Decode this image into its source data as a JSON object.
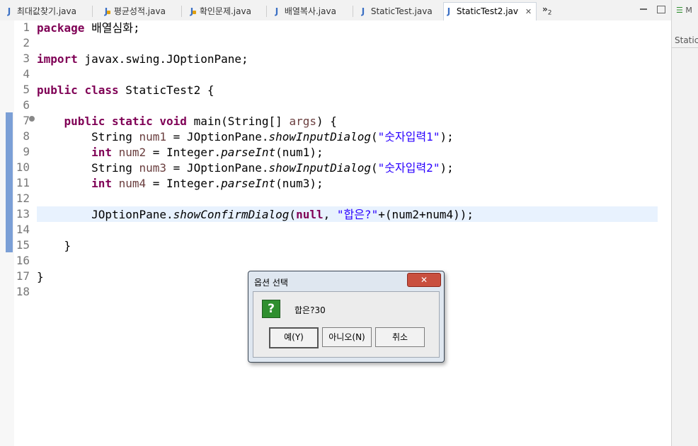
{
  "tabs": [
    {
      "label": "최대값찾기.java",
      "icon": "java-file-icon"
    },
    {
      "label": "평균성적.java",
      "icon": "java-file-warning-icon"
    },
    {
      "label": "확인문제.java",
      "icon": "java-file-warning-icon"
    },
    {
      "label": "배열복사.java",
      "icon": "java-file-icon"
    },
    {
      "label": "StaticTest.java",
      "icon": "java-file-icon"
    },
    {
      "label": "StaticTest2.jav",
      "icon": "java-file-icon"
    }
  ],
  "tab_close": "✕",
  "overflow": {
    "label": "»",
    "count": "2"
  },
  "right_panel": {
    "top": "M",
    "label": "StaticT"
  },
  "line_numbers": [
    "1",
    "2",
    "3",
    "4",
    "5",
    "6",
    "7",
    "8",
    "9",
    "10",
    "11",
    "12",
    "13",
    "14",
    "15",
    "16",
    "17",
    "18"
  ],
  "code": {
    "l1": {
      "kw": "package",
      "rest": " 배열심화;"
    },
    "l3": {
      "kw": "import",
      "rest": " javax.swing.JOptionPane;"
    },
    "l5": {
      "kw1": "public",
      "kw2": "class",
      "rest": " StaticTest2 {"
    },
    "l7": {
      "indent": "    ",
      "kw1": "public",
      "kw2": "static",
      "kw3": "void",
      "rest": " main(String[] ",
      "param": "args",
      "end": ") {"
    },
    "l8": {
      "pre": "        String ",
      "v": "num1",
      "mid": " = JOptionPane.",
      "method": "showInputDialog",
      "open": "(",
      "str": "\"숫자입력1\"",
      "end": ");"
    },
    "l9": {
      "indent": "        ",
      "kw": "int",
      "v": " num2",
      "mid": " = Integer.",
      "method": "parseInt",
      "end": "(num1);"
    },
    "l10": {
      "pre": "        String ",
      "v": "num3",
      "mid": " = JOptionPane.",
      "method": "showInputDialog",
      "open": "(",
      "str": "\"숫자입력2\"",
      "end": ");"
    },
    "l11": {
      "indent": "        ",
      "kw": "int",
      "v": " num4",
      "mid": " = Integer.",
      "method": "parseInt",
      "end": "(num3);"
    },
    "l13": {
      "pre": "        JOptionPane.",
      "method": "showConfirmDialog",
      "open": "(",
      "kw": "null",
      "comma": ", ",
      "str": "\"합은?\"",
      "end": "+(num2+num4));"
    },
    "l15": {
      "text": "    }"
    },
    "l17": {
      "text": "}"
    }
  },
  "dialog": {
    "title": "옵션 선택",
    "close": "✕",
    "icon": "question-icon",
    "icon_glyph": "?",
    "message": "합은?30",
    "buttons": {
      "yes": "예(Y)",
      "no": "아니오(N)",
      "cancel": "취소"
    }
  }
}
